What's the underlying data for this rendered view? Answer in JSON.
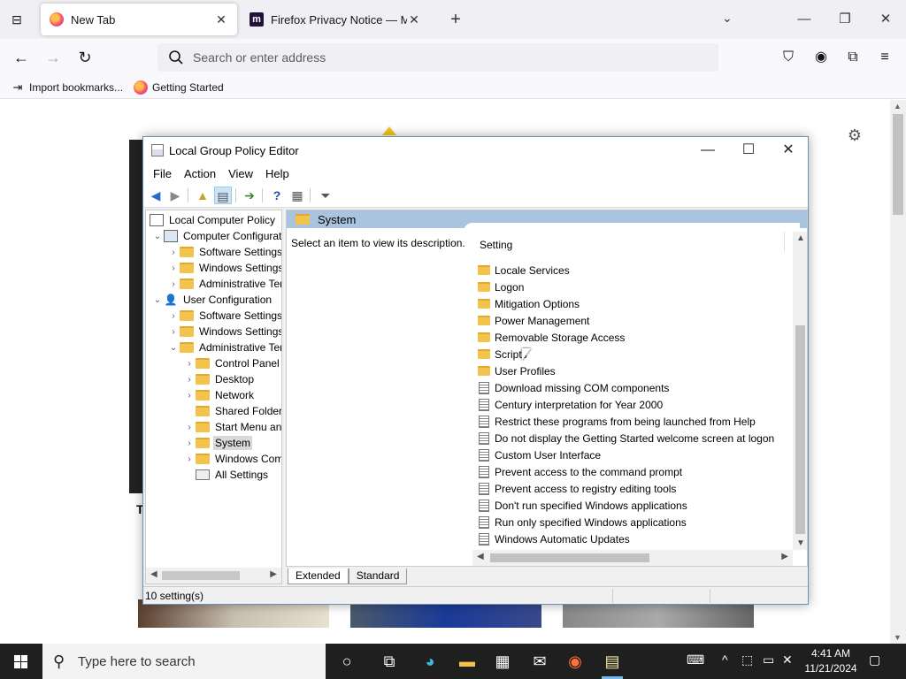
{
  "firefox": {
    "tabs": [
      {
        "title": "New Tab",
        "active": true
      },
      {
        "title": "Firefox Privacy Notice — Mozilla",
        "active": false
      }
    ],
    "urlbar_placeholder": "Search or enter address",
    "bookmarks": [
      {
        "label": "Import bookmarks..."
      },
      {
        "label": "Getting Started"
      }
    ]
  },
  "gpe": {
    "title": "Local Group Policy Editor",
    "menu": [
      "File",
      "Action",
      "View",
      "Help"
    ],
    "tree": [
      {
        "label": "Local Computer Policy",
        "level": 0,
        "expand": "",
        "icon": "policy"
      },
      {
        "label": "Computer Configuration",
        "level": 1,
        "expand": "open",
        "icon": "computer"
      },
      {
        "label": "Software Settings",
        "level": 2,
        "expand": "closed",
        "icon": "folder"
      },
      {
        "label": "Windows Settings",
        "level": 2,
        "expand": "closed",
        "icon": "folder"
      },
      {
        "label": "Administrative Templates",
        "level": 2,
        "expand": "closed",
        "icon": "folder"
      },
      {
        "label": "User Configuration",
        "level": 1,
        "expand": "open",
        "icon": "user"
      },
      {
        "label": "Software Settings",
        "level": 2,
        "expand": "closed",
        "icon": "folder"
      },
      {
        "label": "Windows Settings",
        "level": 2,
        "expand": "closed",
        "icon": "folder"
      },
      {
        "label": "Administrative Templates",
        "level": 2,
        "expand": "open",
        "icon": "folder"
      },
      {
        "label": "Control Panel",
        "level": 3,
        "expand": "closed",
        "icon": "folder"
      },
      {
        "label": "Desktop",
        "level": 3,
        "expand": "closed",
        "icon": "folder"
      },
      {
        "label": "Network",
        "level": 3,
        "expand": "closed",
        "icon": "folder"
      },
      {
        "label": "Shared Folders",
        "level": 3,
        "expand": "",
        "icon": "folder"
      },
      {
        "label": "Start Menu and Taskbar",
        "level": 3,
        "expand": "closed",
        "icon": "folder"
      },
      {
        "label": "System",
        "level": 3,
        "expand": "closed",
        "icon": "folder",
        "selected": true
      },
      {
        "label": "Windows Components",
        "level": 3,
        "expand": "closed",
        "icon": "folder"
      },
      {
        "label": "All Settings",
        "level": 3,
        "expand": "",
        "icon": "allsettings"
      }
    ],
    "right_header": "System",
    "description": "Select an item to view its description.",
    "column_header": "Setting",
    "items": [
      {
        "label": "Locale Services",
        "type": "folder"
      },
      {
        "label": "Logon",
        "type": "folder"
      },
      {
        "label": "Mitigation Options",
        "type": "folder"
      },
      {
        "label": "Power Management",
        "type": "folder"
      },
      {
        "label": "Removable Storage Access",
        "type": "folder"
      },
      {
        "label": "Scripts",
        "type": "folder"
      },
      {
        "label": "User Profiles",
        "type": "folder"
      },
      {
        "label": "Download missing COM components",
        "type": "setting"
      },
      {
        "label": "Century interpretation for Year 2000",
        "type": "setting"
      },
      {
        "label": "Restrict these programs from being launched from Help",
        "type": "setting"
      },
      {
        "label": "Do not display the Getting Started welcome screen at logon",
        "type": "setting"
      },
      {
        "label": "Custom User Interface",
        "type": "setting"
      },
      {
        "label": "Prevent access to the command prompt",
        "type": "setting"
      },
      {
        "label": "Prevent access to registry editing tools",
        "type": "setting"
      },
      {
        "label": "Don't run specified Windows applications",
        "type": "setting"
      },
      {
        "label": "Run only specified Windows applications",
        "type": "setting"
      },
      {
        "label": "Windows Automatic Updates",
        "type": "setting"
      }
    ],
    "view_tabs": [
      "Extended",
      "Standard"
    ],
    "status": "10 setting(s)"
  },
  "taskbar": {
    "search_placeholder": "Type here to search",
    "time": "4:41 AM",
    "date": "11/21/2024"
  },
  "colors": {
    "accent_blue": "#a9c4de",
    "folder": "#f3c44d",
    "taskbar": "#1f1f1f"
  }
}
